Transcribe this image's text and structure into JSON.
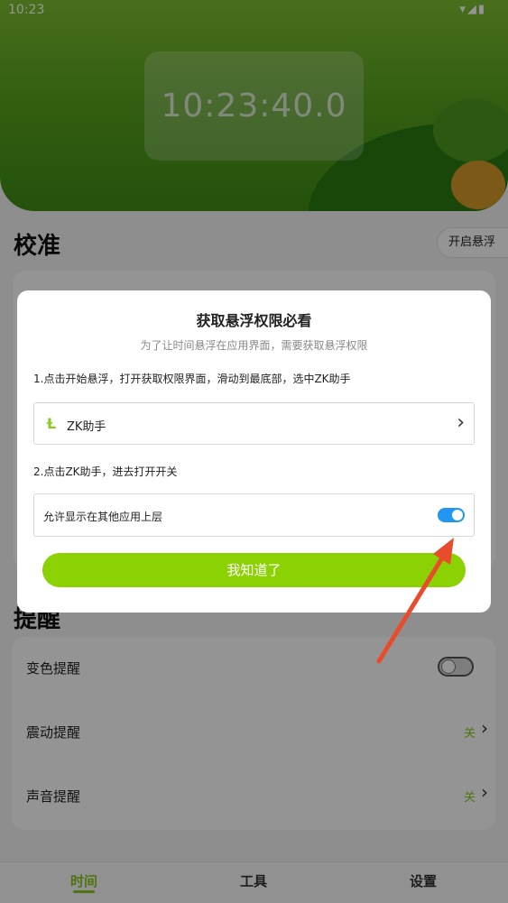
{
  "status_bar": {
    "time": "10:23",
    "icons": "▾◢▮"
  },
  "hero": {
    "clock": "10:23:40.0"
  },
  "calibration": {
    "title": "校准",
    "float_button": "开启悬浮"
  },
  "reminders": {
    "title": "提醒",
    "items": [
      {
        "label": "变色提醒",
        "type": "toggle",
        "on": false
      },
      {
        "label": "震动提醒",
        "value": "关"
      },
      {
        "label": "声音提醒",
        "value": "关"
      }
    ]
  },
  "tabs": [
    {
      "label": "时间",
      "active": true
    },
    {
      "label": "工具",
      "active": false
    },
    {
      "label": "设置",
      "active": false
    }
  ],
  "dialog": {
    "title": "获取悬浮权限必看",
    "subtitle": "为了让时间悬浮在应用界面，需要获取悬浮权限",
    "step1": "1.点击开始悬浮，打开获取权限界面，滑动到最底部，选中ZK助手",
    "app_name": "ZK助手",
    "app_logo": "Ɫ",
    "step2": "2.点击ZK助手，进去打开开关",
    "permission_label": "允许显示在其他应用上层",
    "permission_on": true,
    "confirm_button": "我知道了"
  },
  "colors": {
    "accent": "#8cc820",
    "toggle_blue": "#2196f3",
    "arrow": "#e84c2c"
  }
}
